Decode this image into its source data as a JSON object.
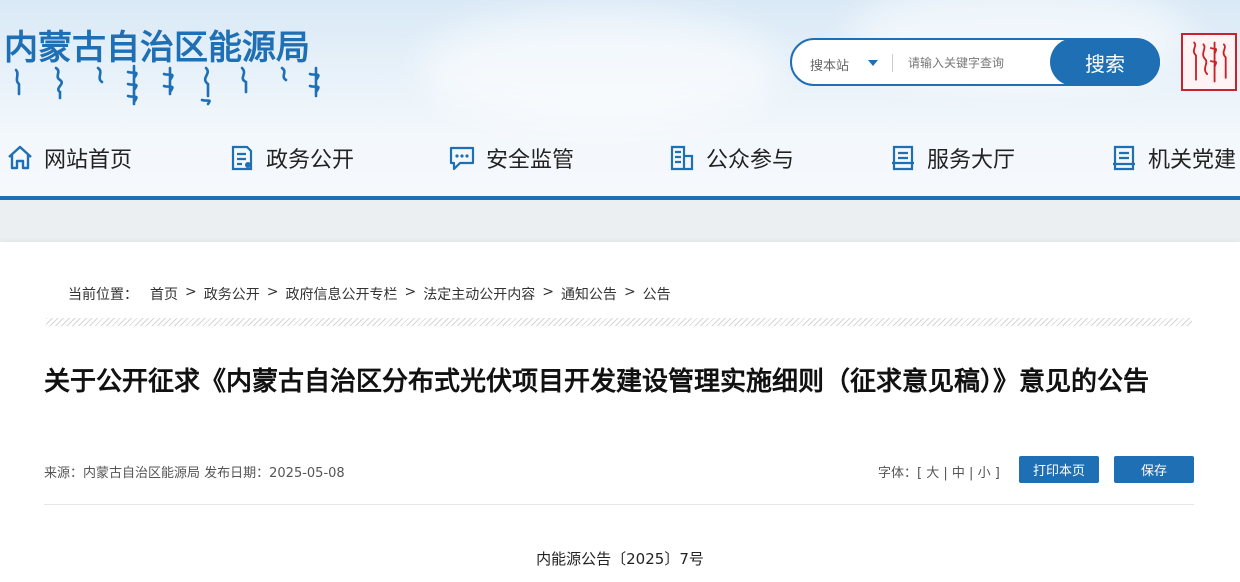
{
  "header": {
    "site_title": "内蒙古自治区能源局",
    "search": {
      "scope_label": "搜本站",
      "placeholder": "请输入关键字查询",
      "button_label": "搜索"
    }
  },
  "nav": {
    "items": [
      {
        "label": "网站首页",
        "icon": "home-icon"
      },
      {
        "label": "政务公开",
        "icon": "document-list-icon"
      },
      {
        "label": "安全监管",
        "icon": "chat-bubble-icon"
      },
      {
        "label": "公众参与",
        "icon": "forms-icon"
      },
      {
        "label": "服务大厅",
        "icon": "service-icon"
      },
      {
        "label": "机关党建",
        "icon": "book-icon"
      }
    ]
  },
  "breadcrumb": {
    "prefix": "当前位置：",
    "items": [
      "首页",
      "政务公开",
      "政府信息公开专栏",
      "法定主动公开内容",
      "通知公告",
      "公告"
    ],
    "separator": ">"
  },
  "article": {
    "title": "关于公开征求《内蒙古自治区分布式光伏项目开发建设管理实施细则（征求意见稿）》意见的公告",
    "meta": "来源：内蒙古自治区能源局 发布日期：2025-05-08",
    "font_size_label": "字体：[",
    "font_sizes": [
      "大",
      "中",
      "小"
    ],
    "font_close": "]",
    "print_label": "打印本页",
    "save_label": "保存",
    "doc_number": "内能源公告〔2025〕7号"
  },
  "colors": {
    "accent": "#1f6fb4",
    "seal": "#c8232c"
  }
}
